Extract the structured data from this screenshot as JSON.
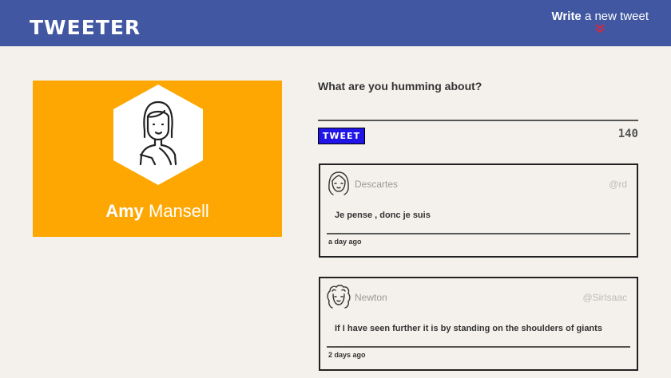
{
  "header": {
    "brand": "TWEETER",
    "write_strong": "Write",
    "write_light": "a new tweet",
    "chevron_icon": "double-chevron-down-icon",
    "chevron_color": "#e0243c",
    "background": "#4157a1"
  },
  "profile": {
    "first_name": "Amy",
    "last_name": "Mansell",
    "avatar_icon": "woman-avatar-icon",
    "card_color": "#fea702"
  },
  "composer": {
    "prompt": "What are you humming about?",
    "input_value": "",
    "button_label": "TWEET",
    "button_color": "#2014e6",
    "char_count": "140"
  },
  "tweets": [
    {
      "author": "Descartes",
      "handle": "@rd",
      "text": "Je pense , donc je suis",
      "time": "a day ago",
      "avatar_icon": "descartes-avatar-icon"
    },
    {
      "author": "Newton",
      "handle": "@SirIsaac",
      "text": "If I have seen further it is by standing on the shoulders of giants",
      "time": "2 days ago",
      "avatar_icon": "newton-avatar-icon"
    }
  ]
}
